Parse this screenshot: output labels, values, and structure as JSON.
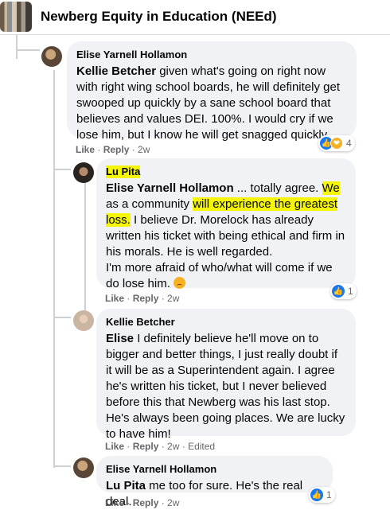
{
  "header": {
    "group_name": "Newberg Equity in Education (NEEd)"
  },
  "comments": [
    {
      "author": "Elise Yarnell Hollamon",
      "mention": "Kellie Betcher",
      "text": " given what's going on right now with right wing school boards, he will definitely get swooped up quickly by a sane school board that believes and values DEI. 100%. I would cry if we lose him, but I know he will get snagged quickly.",
      "like": "Like",
      "reply": "Reply",
      "time": "2w",
      "reaction_count": "4"
    },
    {
      "author": "Lu Pita",
      "mention": "Elise Yarnell Hollamon",
      "text_a": " ... totally agree. ",
      "text_hl1": "We",
      "text_b": " as a community ",
      "text_hl2": "will experience the greatest loss.",
      "text_c": " I believe Dr. Morelock has already written his ticket with being ethical and firm in his morals. He is well regarded.",
      "text_d": "I'm more afraid of who/what will come if we do lose him.",
      "like": "Like",
      "reply": "Reply",
      "time": "2w",
      "reaction_count": "1"
    },
    {
      "author": "Kellie Betcher",
      "mention": "Elise",
      "text": " I definitely believe he'll move on to bigger and better things, I just really doubt if it will be as a Superintendent again. I agree he's written his ticket, but I never believed before this that Newberg was his last stop. He's always been going places. We are lucky to have him!",
      "like": "Like",
      "reply": "Reply",
      "time": "2w",
      "edited": "Edited"
    },
    {
      "author": "Elise Yarnell Hollamon",
      "mention": "Lu Pita",
      "text": " me too for sure. He's the real deal.",
      "like": "Like",
      "reply": "Reply",
      "time": "2w",
      "reaction_count": "1"
    }
  ],
  "icons": {
    "like": "like-icon",
    "care": "care-icon",
    "sad": "sad-emoji-icon"
  },
  "colors": {
    "bubble": "#f0f2f5",
    "highlight": "#f5f50a",
    "like_blue": "#1877f2",
    "meta_gray": "#65676b"
  }
}
